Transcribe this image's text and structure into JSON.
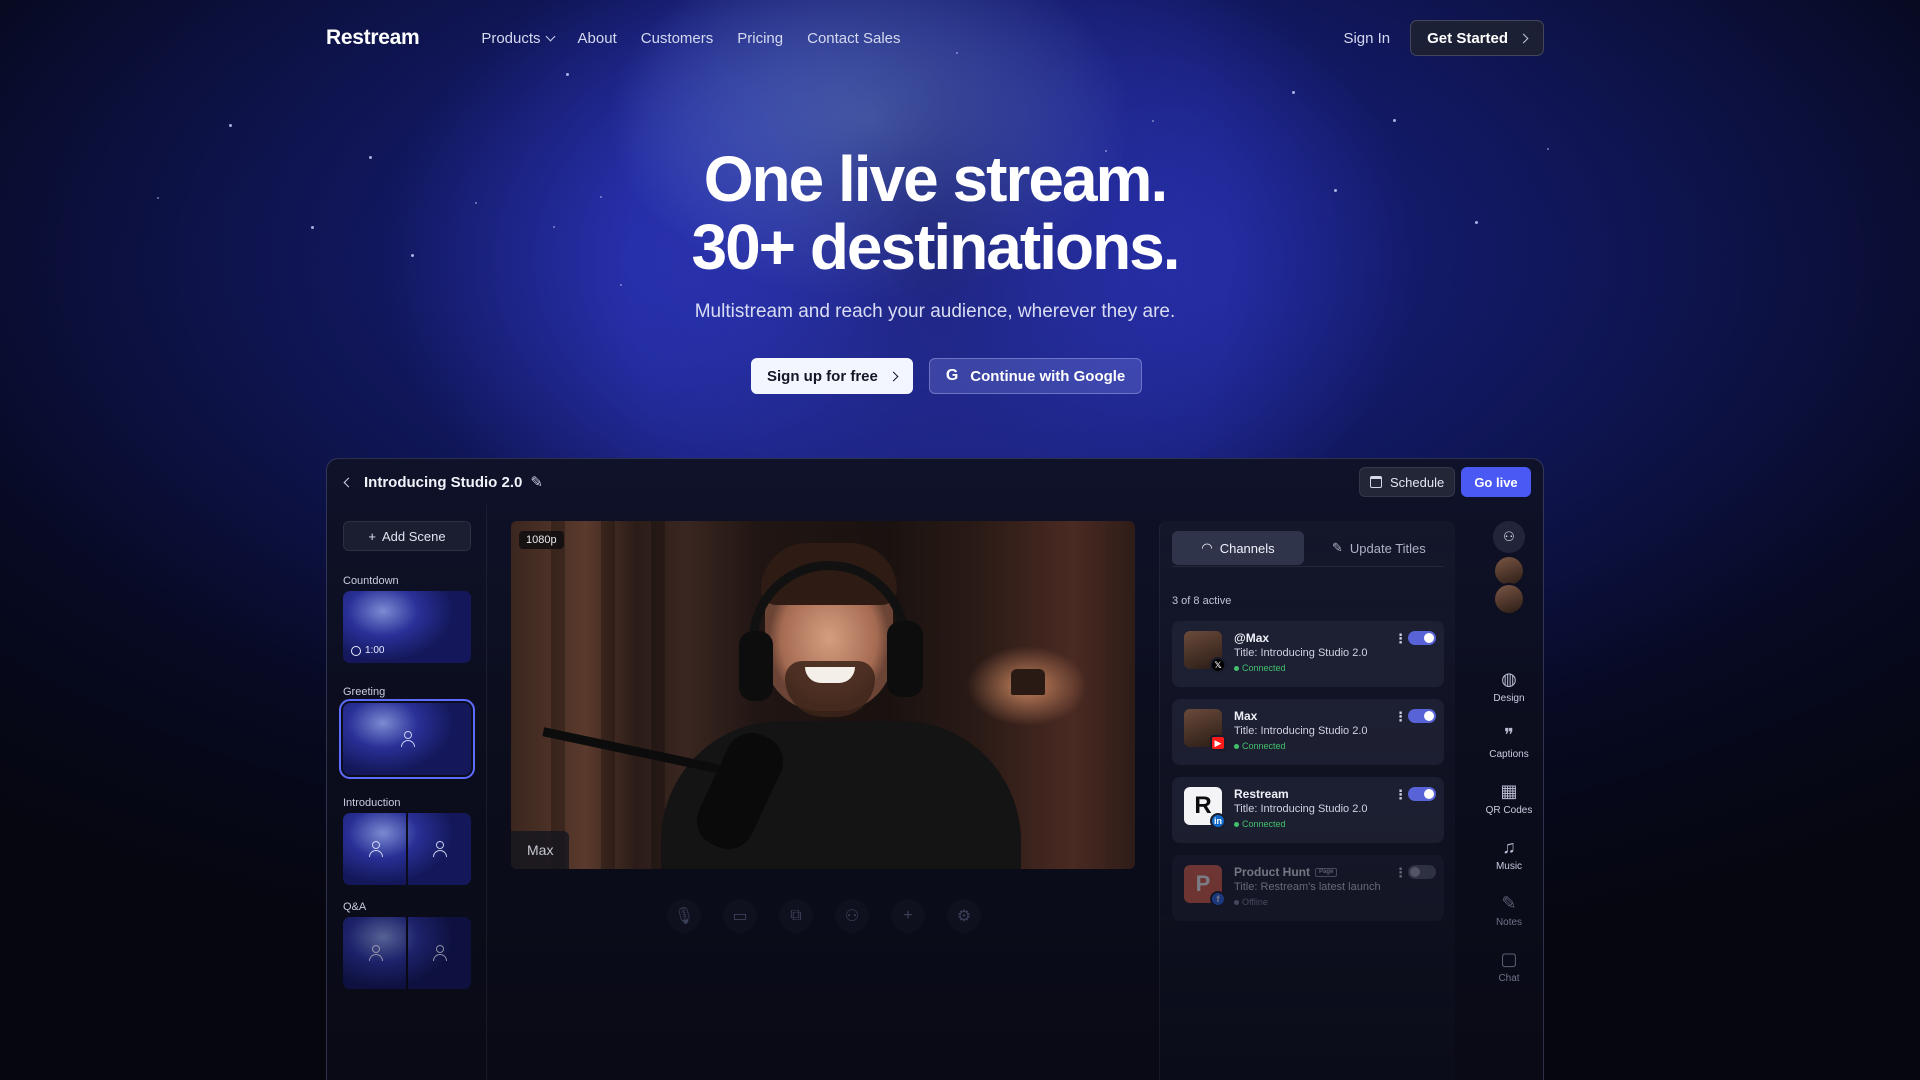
{
  "nav": {
    "logo": "Restream",
    "links": [
      "Products",
      "About",
      "Customers",
      "Pricing",
      "Contact Sales"
    ],
    "sign_in": "Sign In",
    "get_started": "Get Started"
  },
  "hero": {
    "title_line1": "One live stream.",
    "title_line2": "30+ destinations.",
    "subtitle": "Multistream and reach your audience, wherever they are.",
    "cta_primary": "Sign up for free",
    "cta_google": "Continue with Google",
    "google_icon": "G"
  },
  "studio": {
    "title": "Introducing Studio 2.0",
    "schedule": "Schedule",
    "go_live": "Go live",
    "add_scene": "Add Scene",
    "scenes": [
      {
        "label": "Countdown",
        "timer": "1:00"
      },
      {
        "label": "Greeting"
      },
      {
        "label": "Introduction"
      },
      {
        "label": "Q&A"
      }
    ],
    "video": {
      "resolution": "1080p",
      "name_tag": "Max"
    },
    "controls": [
      "mic-icon",
      "camera-icon",
      "screen-share-icon",
      "add-guest-icon",
      "plus-icon",
      "settings-icon"
    ],
    "channels_panel": {
      "tab_channels": "Channels",
      "tab_update_titles": "Update Titles",
      "active_count": "3 of 8 active",
      "items": [
        {
          "name": "@Max",
          "title": "Title: Introducing Studio 2.0",
          "status": "Connected",
          "platform": "X",
          "enabled": true
        },
        {
          "name": "Max",
          "title": "Title: Introducing Studio 2.0",
          "status": "Connected",
          "platform": "YouTube",
          "enabled": true
        },
        {
          "name": "Restream",
          "title": "Title: Introducing Studio 2.0",
          "status": "Connected",
          "platform": "in",
          "enabled": true,
          "avatar_letter": "R"
        },
        {
          "name": "Product Hunt",
          "badge": "Page",
          "title": "Title: Restream's latest launch",
          "status": "Offline",
          "platform": "Facebook",
          "enabled": false,
          "avatar_letter": "P"
        }
      ]
    },
    "tools": [
      "Design",
      "Captions",
      "QR Codes",
      "Music",
      "Notes",
      "Chat"
    ]
  },
  "colors": {
    "accent": "#4a58f4",
    "connected": "#42c16c",
    "toggle_on": "#5863d8"
  }
}
